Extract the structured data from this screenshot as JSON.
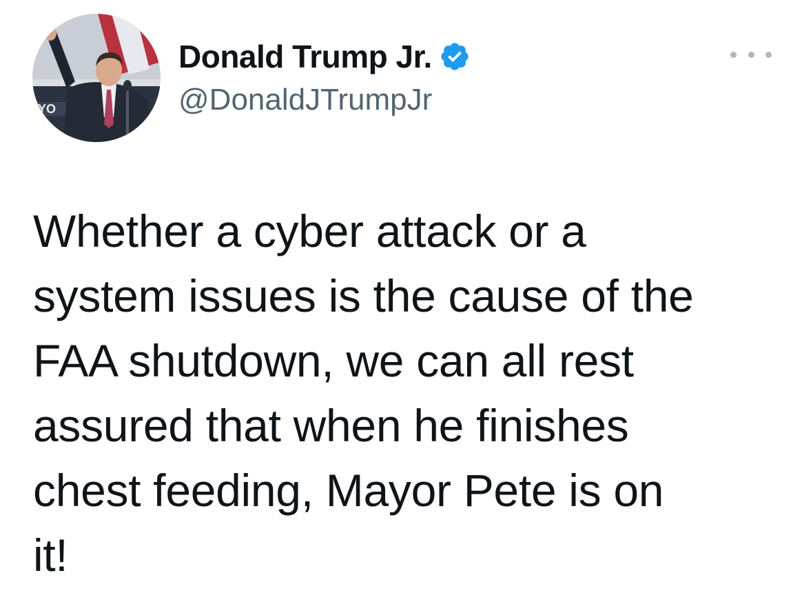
{
  "tweet": {
    "author": {
      "display_name": "Donald Trump Jr.",
      "handle": "@DonaldJTrumpJr",
      "verified": true,
      "verified_icon": "verified-badge-icon",
      "avatar_icon": "profile-photo"
    },
    "more_icon": "more-options-icon",
    "text_lines": [
      "Whether a cyber attack or a",
      "system issues is the cause of the",
      "FAA shutdown, we can all rest",
      "assured that when he finishes",
      "chest feeding, Mayor Pete is on",
      "it!"
    ]
  },
  "colors": {
    "text": "#0f1419",
    "secondary_text": "#536471",
    "verified_blue": "#1d9bf0",
    "more_dots": "#b0b8bf",
    "background": "#ffffff"
  }
}
